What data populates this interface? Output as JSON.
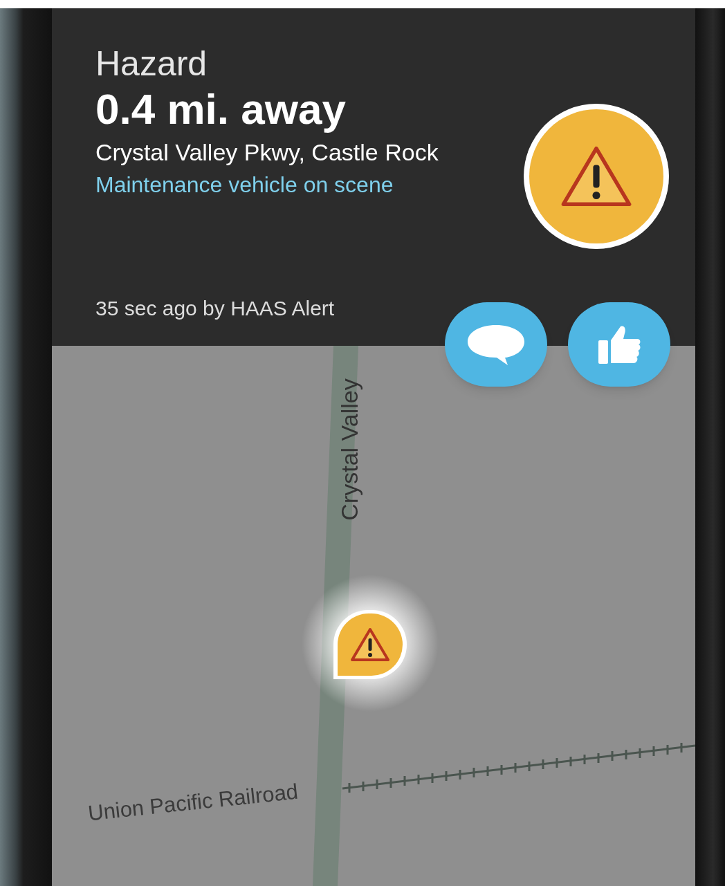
{
  "alert": {
    "type": "Hazard",
    "distance": "0.4 mi. away",
    "location": "Crystal Valley Pkwy, Castle Rock",
    "description": "Maintenance vehicle on scene",
    "reported": "35 sec ago by HAAS Alert"
  },
  "actions": [
    {
      "kind": "comment"
    },
    {
      "kind": "thumbs-up"
    }
  ],
  "map": {
    "road_labels": [
      {
        "kind": "vertical",
        "text": "Crystal Valley"
      },
      {
        "kind": "slanted",
        "text": "Union Pacific Railroad"
      }
    ]
  }
}
